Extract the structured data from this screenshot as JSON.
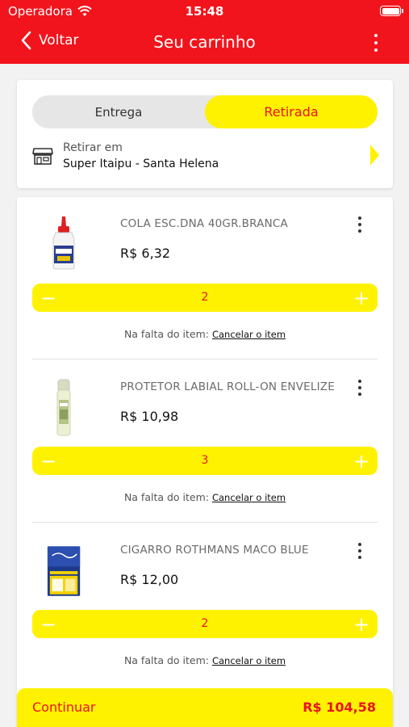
{
  "status_bar": {
    "carrier": "Operadora",
    "time": "15:48"
  },
  "nav": {
    "back_label": "Voltar",
    "title": "Seu carrinho"
  },
  "delivery": {
    "tabs": [
      {
        "label": "Entrega",
        "active": false
      },
      {
        "label": "Retirada",
        "active": true
      }
    ],
    "pickup_label": "Retirar em",
    "store_name": "Super Itaipu - Santa Helena"
  },
  "items": [
    {
      "name": "COLA ESC.DNA 40GR.BRANCA",
      "price": "R$ 6,32",
      "quantity": "2",
      "missing_label": "Na falta do item:",
      "missing_action": "Cancelar o item",
      "image": "glue-bottle"
    },
    {
      "name": "PROTETOR LABIAL ROLL-ON ENVELIZE",
      "price": "R$ 10,98",
      "quantity": "3",
      "missing_label": "Na falta do item:",
      "missing_action": "Cancelar o item",
      "image": "lip-roller"
    },
    {
      "name": "CIGARRO ROTHMANS MACO BLUE",
      "price": "R$ 12,00",
      "quantity": "2",
      "missing_label": "Na falta do item:",
      "missing_action": "Cancelar o item",
      "image": "cigarette-pack"
    }
  ],
  "footer": {
    "continue_label": "Continuar",
    "total": "R$ 104,58"
  },
  "colors": {
    "brand_red": "#f2141c",
    "accent_yellow": "#fff200",
    "text_red": "#e8141c"
  }
}
